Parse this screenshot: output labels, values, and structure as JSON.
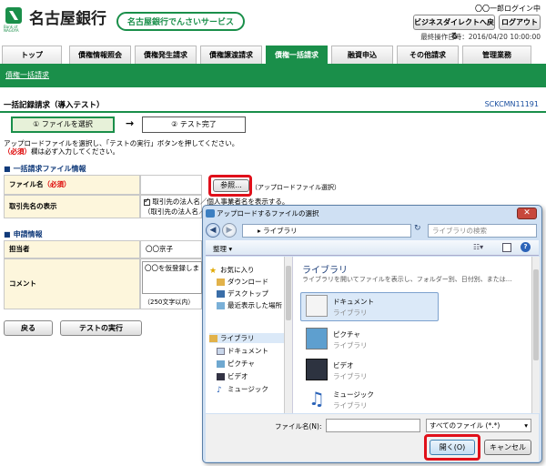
{
  "header": {
    "bank_name": "名古屋銀行",
    "bank_name_en": "Bank of NAGOYA",
    "service_name": "名古屋銀行でんさいサービス",
    "login_user": "〇〇一郎ログイン中",
    "direct_back_label": "ビジネスダイレクトへ戻る",
    "logout_label": "ログアウト",
    "last_operation": "最終操作日時：2016/04/20 10:00:00"
  },
  "tabs": [
    {
      "label": "トップ"
    },
    {
      "label": "債権情報照会"
    },
    {
      "label": "債権発生請求"
    },
    {
      "label": "債権譲渡請求"
    },
    {
      "label": "債権一括請求"
    },
    {
      "label": "融資申込"
    },
    {
      "label": "その他請求"
    },
    {
      "label": "管理業務"
    }
  ],
  "subnav": {
    "link": "債権一括請求"
  },
  "page": {
    "title": "一括記録請求（導入テスト）",
    "screen_id": "SCKCMN11191",
    "step1": "① ファイルを選択",
    "step_arrow": "→",
    "step2": "② テスト完了",
    "instruction1": "アップロードファイルを選択し、「テストの実行」ボタンを押してください。",
    "instruction2_req": "（必須）",
    "instruction2": "欄は必ず入力してください。"
  },
  "file_section": {
    "title": "一括請求ファイル情報",
    "file_name_label": "ファイル名",
    "required_tag": "（必須）",
    "browse_label": "参照...",
    "browse_note": "（アップロードファイル選択）",
    "display_label": "取引先名の表示",
    "display_check": "取引先の法人名／個人事業者名を表示する。",
    "display_note": "（取引先の法人名／"
  },
  "applicant_section": {
    "title": "申請情報",
    "person_label": "担当者",
    "person_value": "〇〇京子",
    "comment_label": "コメント",
    "comment_value": "〇〇を仮登録しま",
    "comment_limit": "（250文字以内）"
  },
  "buttons": {
    "back": "戻る",
    "run_test": "テストの実行"
  },
  "dialog": {
    "title": "アップロードするファイルの選択",
    "address": "ライブラリ",
    "address_arrow": "▸",
    "search_placeholder": "ライブラリの検索",
    "organize": "整理 ▾",
    "nav_items": [
      {
        "label": "お気に入り"
      },
      {
        "label": "ダウンロード"
      },
      {
        "label": "デスクトップ"
      },
      {
        "label": "最近表示した場所"
      },
      {
        "label": "ライブラリ"
      },
      {
        "label": "ドキュメント"
      },
      {
        "label": "ピクチャ"
      },
      {
        "label": "ビデオ"
      },
      {
        "label": "ミュージック"
      }
    ],
    "library_title": "ライブラリ",
    "library_desc": "ライブラリを開いてファイルを表示し、フォルダー別、日付別、または...",
    "libraries": [
      {
        "name": "ドキュメント",
        "sub": "ライブラリ"
      },
      {
        "name": "ピクチャ",
        "sub": "ライブラリ"
      },
      {
        "name": "ビデオ",
        "sub": "ライブラリ"
      },
      {
        "name": "ミュージック",
        "sub": "ライブラリ"
      }
    ],
    "filename_label": "ファイル名(N):",
    "filter": "すべてのファイル (*.*)",
    "open_label": "開く(O)",
    "cancel_label": "キャンセル"
  }
}
